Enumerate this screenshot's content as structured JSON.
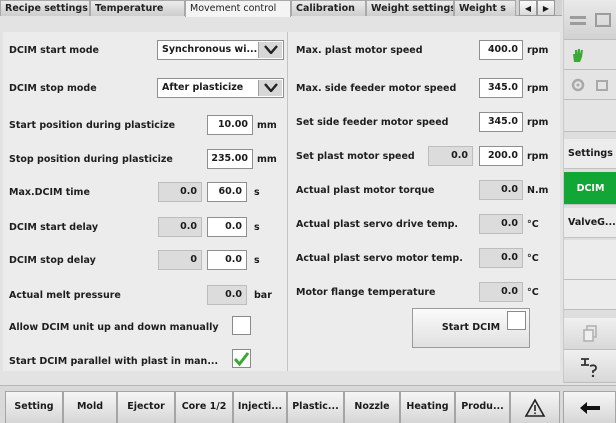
{
  "top_tabs": [
    "Recipe settings",
    "Temperature",
    "Movement control",
    "Calibration",
    "Weight settings",
    "Weight s"
  ],
  "left": {
    "start_mode_label": "DCIM start mode",
    "start_mode_value": "Synchronous wi...",
    "stop_mode_label": "DCIM stop mode",
    "stop_mode_value": "After plasticize",
    "start_pos_label": "Start position during plasticize",
    "start_pos_value": "10.00",
    "start_pos_unit": "mm",
    "stop_pos_label": "Stop position during plasticize",
    "stop_pos_value": "235.00",
    "stop_pos_unit": "mm",
    "max_time_label": "Max.DCIM time",
    "max_time_actual": "0.0",
    "max_time_value": "60.0",
    "max_time_unit": "s",
    "start_delay_label": "DCIM start delay",
    "start_delay_actual": "0.0",
    "start_delay_value": "0.0",
    "start_delay_unit": "s",
    "stop_delay_label": "DCIM stop delay",
    "stop_delay_actual": "0",
    "stop_delay_value": "0.0",
    "stop_delay_unit": "s",
    "melt_label": "Actual melt pressure",
    "melt_value": "0.0",
    "melt_unit": "bar",
    "allow_label": "Allow DCIM unit up and down manually",
    "allow_checked": false,
    "parallel_label": "Start DCIM parallel with plast in man...",
    "parallel_checked": true
  },
  "right": {
    "max_plast_label": "Max. plast motor speed",
    "max_plast_value": "400.0",
    "max_plast_unit": "rpm",
    "max_side_label": "Max. side feeder motor speed",
    "max_side_value": "345.0",
    "max_side_unit": "rpm",
    "set_side_label": "Set side feeder motor speed",
    "set_side_value": "345.0",
    "set_side_unit": "rpm",
    "set_plast_label": "Set plast motor speed",
    "set_plast_actual": "0.0",
    "set_plast_value": "200.0",
    "set_plast_unit": "rpm",
    "torque_label": "Actual plast motor torque",
    "torque_value": "0.0",
    "torque_unit": "N.m",
    "servo_drive_label": "Actual plast servo drive temp.",
    "servo_drive_value": "0.0",
    "servo_drive_unit": "°C",
    "servo_motor_label": "Actual plast servo motor temp.",
    "servo_motor_value": "0.0",
    "servo_motor_unit": "°C",
    "flange_label": "Motor flange temperature",
    "flange_value": "0.0",
    "flange_unit": "°C",
    "start_button": "Start DCIM",
    "start_checked": false
  },
  "side_tabs": [
    "Settings",
    "DCIM",
    "ValveG..."
  ],
  "bottom_tabs": [
    "Setting",
    "Mold",
    "Ejector",
    "Core 1/2",
    "Injecti...",
    "Plastic...",
    "Nozzle",
    "Heating",
    "Produ..."
  ],
  "icons": {
    "alarm": "warning-triangle-icon",
    "back": "back-arrow-icon"
  },
  "colors": {
    "accent_green": "#12a637",
    "check_green": "#3aa935"
  }
}
